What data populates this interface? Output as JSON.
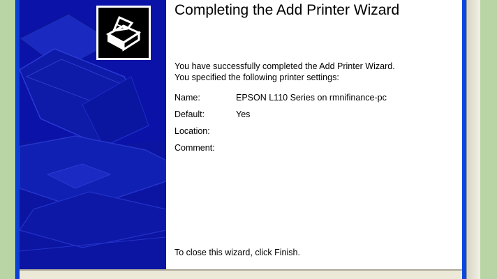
{
  "wizard": {
    "title": "Completing the Add Printer Wizard",
    "intro_line1": "You have successfully completed the Add Printer Wizard.",
    "intro_line2": "You specified the following printer settings:",
    "settings": [
      {
        "label": "Name:",
        "value": "EPSON L110 Series on rmnifinance-pc"
      },
      {
        "label": "Default:",
        "value": "Yes"
      },
      {
        "label": "Location:",
        "value": ""
      },
      {
        "label": "Comment:",
        "value": ""
      }
    ],
    "closing_text": "To close this wizard, click Finish."
  },
  "icons": {
    "wizard_icon": "printer-icon",
    "side_graphic": "printer-graphic"
  },
  "colors": {
    "side_panel": "#0a12a8",
    "frame": "#0a3fd6",
    "background": "#b6d2a3"
  }
}
